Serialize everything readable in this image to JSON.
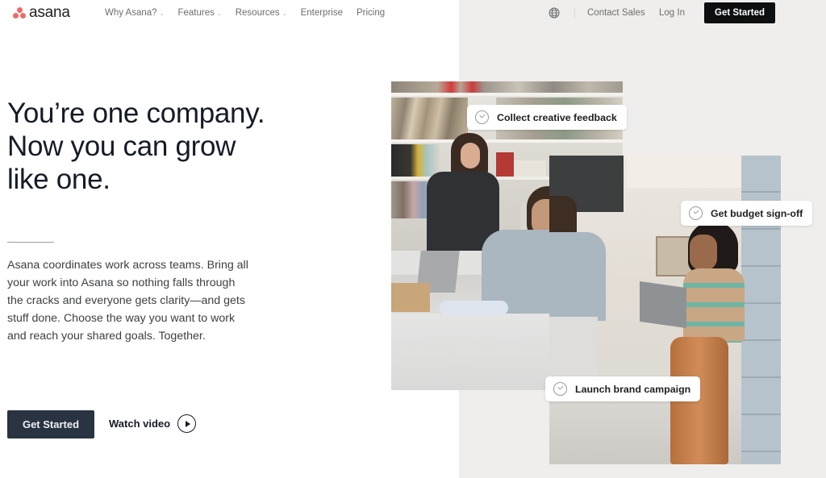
{
  "brand": {
    "name": "asana",
    "logo_color": "#f06a6a"
  },
  "nav": {
    "items": [
      {
        "label": "Why Asana?",
        "has_dropdown": true
      },
      {
        "label": "Features",
        "has_dropdown": true
      },
      {
        "label": "Resources",
        "has_dropdown": true
      },
      {
        "label": "Enterprise",
        "has_dropdown": false
      },
      {
        "label": "Pricing",
        "has_dropdown": false
      }
    ],
    "language_icon": "globe-icon",
    "contact_sales": "Contact Sales",
    "log_in": "Log In",
    "get_started": "Get Started"
  },
  "hero": {
    "title_lines": [
      "You’re one company.",
      "Now you can grow",
      "like one."
    ],
    "body": "Asana coordinates work across teams. Bring all your work into Asana so nothing falls through the cracks and everyone gets clarity—and gets stuff done. Choose the way you want to work and reach your shared goals. Together.",
    "primary_cta": "Get Started",
    "secondary_cta": "Watch video",
    "secondary_cta_icon": "play-circle-icon"
  },
  "tasks": [
    {
      "label": "Collect creative feedback",
      "icon": "check-circle-icon"
    },
    {
      "label": "Get budget sign-off",
      "icon": "check-circle-icon"
    },
    {
      "label": "Launch brand campaign",
      "icon": "check-circle-icon"
    }
  ],
  "colors": {
    "primary_button": "#2a3342",
    "nav_button": "#0d0e10",
    "right_panel_bg": "#f0eeec"
  }
}
